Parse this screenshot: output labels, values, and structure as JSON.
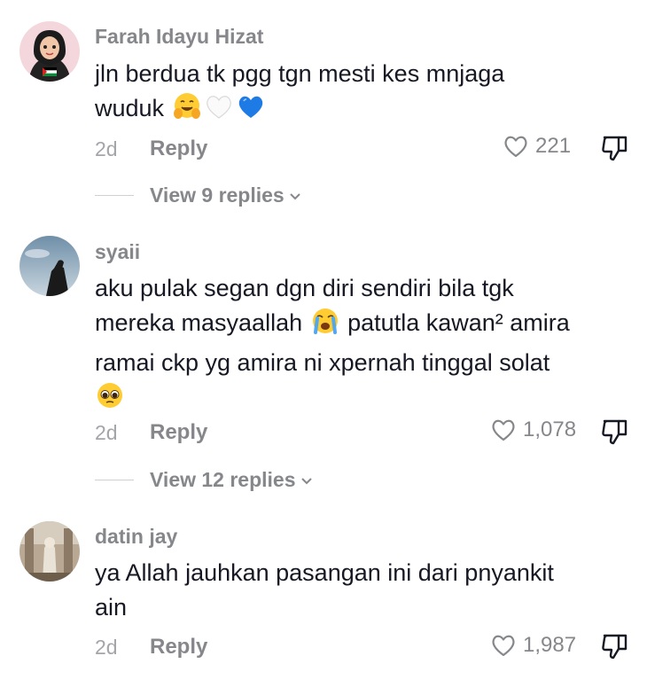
{
  "comments": [
    {
      "username": "Farah Idayu Hizat",
      "text_line1": "jln berdua tk pgg tgn mesti kes mnjaga",
      "text_line2": "wuduk",
      "emojis": [
        "hugging-face-emoji",
        "white-heart-emoji",
        "blue-heart-emoji"
      ],
      "age": "2d",
      "reply_label": "Reply",
      "likes": "221",
      "view_replies": "View 9 replies"
    },
    {
      "username": "syaii",
      "text_line1": "aku pulak segan dgn diri sendiri bila tgk",
      "text_line2a": "mereka masyaallah",
      "text_line2b": "patutla kawan² amira",
      "text_line3": "ramai ckp yg amira ni xpernah tinggal solat",
      "emojis": [
        "loudly-crying-face-emoji",
        "pleading-face-emoji"
      ],
      "age": "2d",
      "reply_label": "Reply",
      "likes": "1,078",
      "view_replies": "View 12 replies"
    },
    {
      "username": "datin jay",
      "text_line1": "ya Allah jauhkan pasangan ini dari pnyankit",
      "text_line2": "ain",
      "age": "2d",
      "reply_label": "Reply",
      "likes": "1,987"
    }
  ],
  "colors": {
    "text": "#161823",
    "secondary": "#86878b",
    "muted": "#a4a5a9"
  }
}
